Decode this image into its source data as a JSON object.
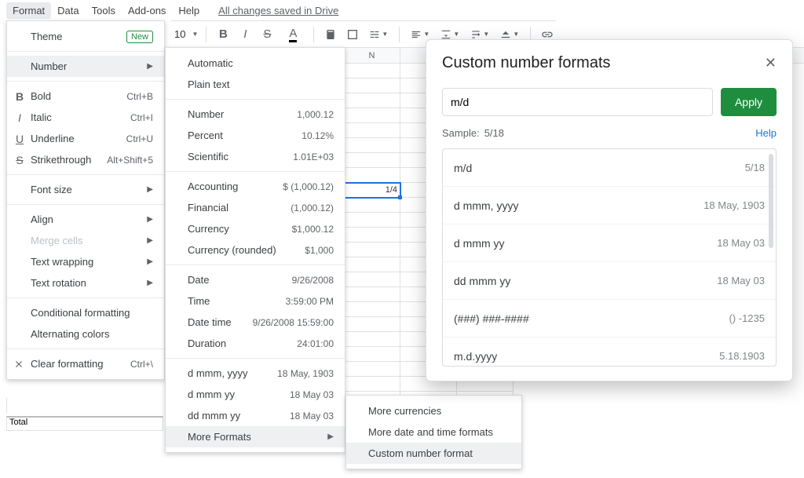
{
  "menubar": {
    "items": [
      "Format",
      "Data",
      "Tools",
      "Add-ons",
      "Help"
    ],
    "saved": "All changes saved in Drive"
  },
  "toolbar": {
    "font_size": "10"
  },
  "format_menu": {
    "theme": "Theme",
    "new_badge": "New",
    "number": "Number",
    "bold": "Bold",
    "bold_kb": "Ctrl+B",
    "italic": "Italic",
    "italic_kb": "Ctrl+I",
    "underline": "Underline",
    "underline_kb": "Ctrl+U",
    "strike": "Strikethrough",
    "strike_kb": "Alt+Shift+5",
    "font_size": "Font size",
    "align": "Align",
    "merge": "Merge cells",
    "wrap": "Text wrapping",
    "rotate": "Text rotation",
    "cond": "Conditional formatting",
    "alt": "Alternating colors",
    "clear": "Clear formatting",
    "clear_kb": "Ctrl+\\"
  },
  "number_menu": {
    "auto": "Automatic",
    "plain": "Plain text",
    "number": "Number",
    "number_s": "1,000.12",
    "percent": "Percent",
    "percent_s": "10.12%",
    "sci": "Scientific",
    "sci_s": "1.01E+03",
    "acct": "Accounting",
    "acct_s": "$ (1,000.12)",
    "fin": "Financial",
    "fin_s": "(1,000.12)",
    "curr": "Currency",
    "curr_s": "$1,000.12",
    "currr": "Currency (rounded)",
    "currr_s": "$1,000",
    "date": "Date",
    "date_s": "9/26/2008",
    "time": "Time",
    "time_s": "3:59:00 PM",
    "datetime": "Date time",
    "datetime_s": "9/26/2008 15:59:00",
    "dur": "Duration",
    "dur_s": "24:01:00",
    "f1": "d mmm, yyyy",
    "f1_s": "18 May, 1903",
    "f2": "d mmm yy",
    "f2_s": "18 May 03",
    "f3": "dd mmm yy",
    "f3_s": "18 May 03",
    "more": "More Formats"
  },
  "more_menu": {
    "curr": "More currencies",
    "dt": "More date and time formats",
    "custom": "Custom number format"
  },
  "sheet": {
    "col_n": "N",
    "active_value": "1/4",
    "total": "Total"
  },
  "dialog": {
    "title": "Custom number formats",
    "input": "m/d",
    "apply": "Apply",
    "sample_label": "Sample:",
    "sample_value": "5/18",
    "help": "Help",
    "items": [
      {
        "fmt": "m/d",
        "ex": "5/18"
      },
      {
        "fmt": "d mmm, yyyy",
        "ex": "18 May, 1903"
      },
      {
        "fmt": "d mmm yy",
        "ex": "18 May 03"
      },
      {
        "fmt": "dd mmm yy",
        "ex": "18 May 03"
      },
      {
        "fmt": "(###) ###-####",
        "ex": "() -1235"
      },
      {
        "fmt": "m.d.yyyy",
        "ex": "5.18.1903"
      }
    ]
  }
}
